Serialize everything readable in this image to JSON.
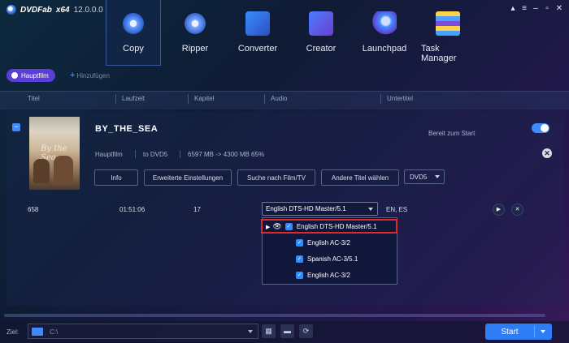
{
  "app": {
    "brand": "DVDFab",
    "arch": "x64",
    "version": "12.0.0.0"
  },
  "window_icons": [
    "pin-icon",
    "menu-icon",
    "minimize-icon",
    "maximize-icon",
    "close-icon"
  ],
  "modules": [
    {
      "label": "Copy",
      "icon": "copy-disc-icon",
      "active": true
    },
    {
      "label": "Ripper",
      "icon": "ripper-disc-icon"
    },
    {
      "label": "Converter",
      "icon": "converter-film-icon"
    },
    {
      "label": "Creator",
      "icon": "creator-film-icon"
    },
    {
      "label": "Launchpad",
      "icon": "rocket-icon"
    },
    {
      "label": "Task Manager",
      "icon": "task-list-icon"
    }
  ],
  "tabs": {
    "main": "Hauptfilm",
    "add": "Hinzufügen"
  },
  "columns": {
    "title": "Titel",
    "runtime": "Laufzeit",
    "chapter": "Kapitel",
    "audio": "Audio",
    "subtitle": "Untertitel"
  },
  "item": {
    "name": "BY_THE_SEA",
    "status": "Bereit zum Start",
    "mode": "Hauptfilm",
    "target": "to DVD5",
    "size": "6597 MB -> 4300 MB 65%",
    "buttons": [
      "Info",
      "Erweiterte Einstellungen",
      "Suche nach Film/TV",
      "Andere Titel wählen"
    ],
    "disc_select": "DVD5",
    "poster_text": "By the Sea",
    "toggle_on": true
  },
  "title_row": {
    "id": "658",
    "runtime": "01:51:06",
    "chapters": "17",
    "audio": "English DTS-HD Master/5.1",
    "subtitles": "EN, ES"
  },
  "audio_tracks": [
    {
      "label": "English DTS-HD Master/5.1",
      "checked": true,
      "highlight": true
    },
    {
      "label": "English AC-3/2",
      "checked": true
    },
    {
      "label": "Spanish AC-3/5.1",
      "checked": true
    },
    {
      "label": "English AC-3/2",
      "checked": true
    }
  ],
  "footer": {
    "ziel": "Ziel:",
    "path": "C:\\",
    "start": "Start"
  },
  "colors": {
    "accent": "#2f7df5",
    "tab": "#5a3fd6",
    "highlight": "#e02a2a"
  }
}
